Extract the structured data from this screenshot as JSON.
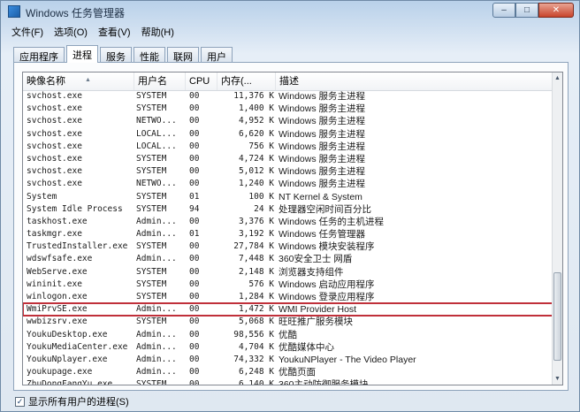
{
  "window": {
    "title": "Windows 任务管理器",
    "minimize": "–",
    "maximize": "□",
    "close": "✕"
  },
  "menu": [
    "文件(F)",
    "选项(O)",
    "查看(V)",
    "帮助(H)"
  ],
  "tabs": [
    "应用程序",
    "进程",
    "服务",
    "性能",
    "联网",
    "用户"
  ],
  "active_tab": "进程",
  "columns": {
    "name": "映像名称",
    "user": "用户名",
    "cpu": "CPU",
    "memory": "内存(...",
    "description": "描述"
  },
  "processes": [
    {
      "name": "svchost.exe",
      "user": "SYSTEM",
      "cpu": "00",
      "mem": "11,376 K",
      "desc": "Windows 服务主进程"
    },
    {
      "name": "svchost.exe",
      "user": "SYSTEM",
      "cpu": "00",
      "mem": "1,400 K",
      "desc": "Windows 服务主进程"
    },
    {
      "name": "svchost.exe",
      "user": "NETWO...",
      "cpu": "00",
      "mem": "4,952 K",
      "desc": "Windows 服务主进程"
    },
    {
      "name": "svchost.exe",
      "user": "LOCAL...",
      "cpu": "00",
      "mem": "6,620 K",
      "desc": "Windows 服务主进程"
    },
    {
      "name": "svchost.exe",
      "user": "LOCAL...",
      "cpu": "00",
      "mem": "756 K",
      "desc": "Windows 服务主进程"
    },
    {
      "name": "svchost.exe",
      "user": "SYSTEM",
      "cpu": "00",
      "mem": "4,724 K",
      "desc": "Windows 服务主进程"
    },
    {
      "name": "svchost.exe",
      "user": "SYSTEM",
      "cpu": "00",
      "mem": "5,012 K",
      "desc": "Windows 服务主进程"
    },
    {
      "name": "svchost.exe",
      "user": "NETWO...",
      "cpu": "00",
      "mem": "1,240 K",
      "desc": "Windows 服务主进程"
    },
    {
      "name": "System",
      "user": "SYSTEM",
      "cpu": "01",
      "mem": "100 K",
      "desc": "NT Kernel & System"
    },
    {
      "name": "System Idle Process",
      "user": "SYSTEM",
      "cpu": "94",
      "mem": "24 K",
      "desc": "处理器空闲时间百分比"
    },
    {
      "name": "taskhost.exe",
      "user": "Admin...",
      "cpu": "00",
      "mem": "3,376 K",
      "desc": "Windows 任务的主机进程"
    },
    {
      "name": "taskmgr.exe",
      "user": "Admin...",
      "cpu": "01",
      "mem": "3,192 K",
      "desc": "Windows 任务管理器"
    },
    {
      "name": "TrustedInstaller.exe",
      "user": "SYSTEM",
      "cpu": "00",
      "mem": "27,784 K",
      "desc": "Windows 模块安装程序"
    },
    {
      "name": "wdswfsafe.exe",
      "user": "Admin...",
      "cpu": "00",
      "mem": "7,448 K",
      "desc": "360安全卫士 网盾"
    },
    {
      "name": "WebServe.exe",
      "user": "SYSTEM",
      "cpu": "00",
      "mem": "2,148 K",
      "desc": "浏览器支持组件"
    },
    {
      "name": "wininit.exe",
      "user": "SYSTEM",
      "cpu": "00",
      "mem": "576 K",
      "desc": "Windows 启动应用程序"
    },
    {
      "name": "winlogon.exe",
      "user": "SYSTEM",
      "cpu": "00",
      "mem": "1,284 K",
      "desc": "Windows 登录应用程序"
    },
    {
      "name": "WmiPrvSE.exe",
      "user": "Admin...",
      "cpu": "00",
      "mem": "1,472 K",
      "desc": "WMI Provider Host",
      "highlight": true
    },
    {
      "name": "wwbizsrv.exe",
      "user": "SYSTEM",
      "cpu": "00",
      "mem": "5,068 K",
      "desc": "旺旺推广服务模块"
    },
    {
      "name": "YoukuDesktop.exe",
      "user": "Admin...",
      "cpu": "00",
      "mem": "98,556 K",
      "desc": "优酷"
    },
    {
      "name": "YoukuMediaCenter.exe",
      "user": "Admin...",
      "cpu": "00",
      "mem": "4,704 K",
      "desc": "优酷媒体中心"
    },
    {
      "name": "YoukuNplayer.exe",
      "user": "Admin...",
      "cpu": "00",
      "mem": "74,332 K",
      "desc": "YoukuNPlayer - The Video Player"
    },
    {
      "name": "youkupage.exe",
      "user": "Admin...",
      "cpu": "00",
      "mem": "6,248 K",
      "desc": "优酷页面"
    },
    {
      "name": "ZhuDongFangYu.exe",
      "user": "SYSTEM",
      "cpu": "00",
      "mem": "6,140 K",
      "desc": "360主动防御服务模块"
    }
  ],
  "footer": {
    "show_all_label": "显示所有用户的进程(S)",
    "checked": "✓"
  },
  "colors": {
    "highlight_outline": "#c0303a"
  }
}
